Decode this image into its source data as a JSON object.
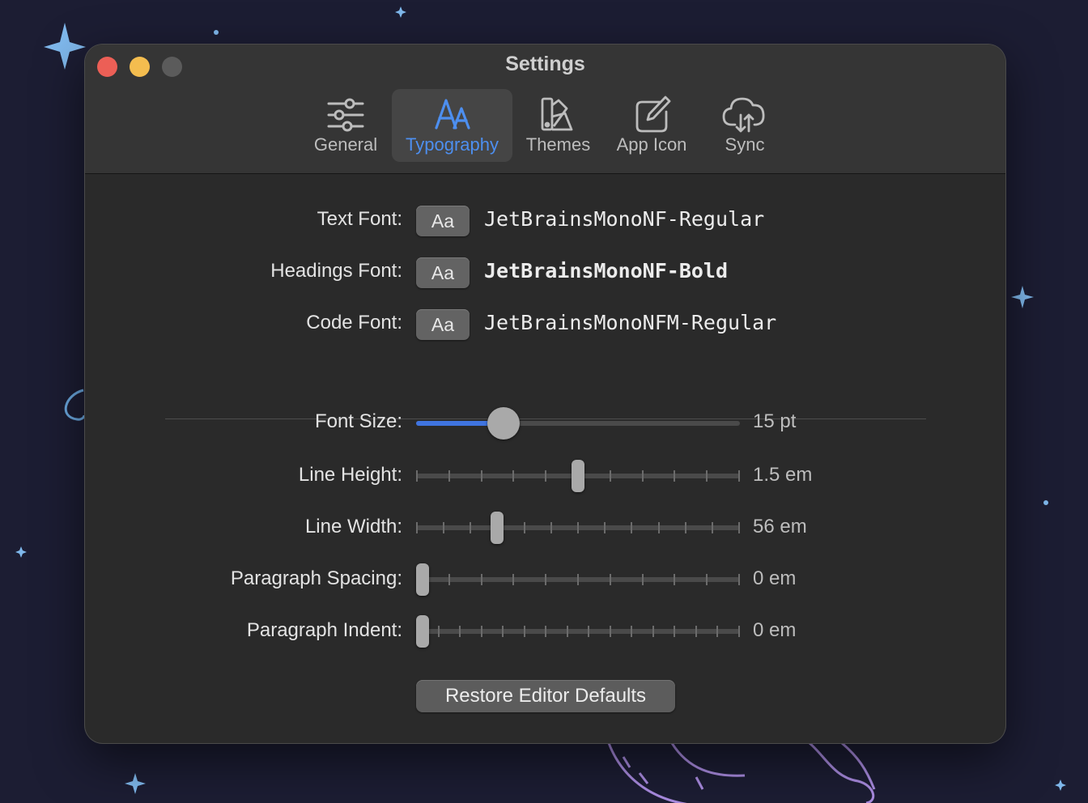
{
  "window": {
    "title": "Settings"
  },
  "tabs": [
    {
      "label": "General",
      "icon": "sliders-icon",
      "active": false
    },
    {
      "label": "Typography",
      "icon": "typography-icon",
      "active": true
    },
    {
      "label": "Themes",
      "icon": "swatches-icon",
      "active": false
    },
    {
      "label": "App Icon",
      "icon": "pencil-square-icon",
      "active": false
    },
    {
      "label": "Sync",
      "icon": "cloud-sync-icon",
      "active": false
    }
  ],
  "fonts": {
    "button_label": "Aa",
    "rows": [
      {
        "label": "Text Font:",
        "value": "JetBrainsMonoNF-Regular",
        "bold": false
      },
      {
        "label": "Headings Font:",
        "value": "JetBrainsMonoNF-Bold",
        "bold": true
      },
      {
        "label": "Code Font:",
        "value": "JetBrainsMonoNFM-Regular",
        "bold": false
      }
    ]
  },
  "sliders": [
    {
      "label": "Font Size:",
      "value": "15 pt",
      "fraction": 0.27,
      "kind": "continuous",
      "tick_count": 0
    },
    {
      "label": "Line Height:",
      "value": "1.5 em",
      "fraction": 0.5,
      "kind": "stepped",
      "tick_count": 11
    },
    {
      "label": "Line Width:",
      "value": "56 em",
      "fraction": 0.25,
      "kind": "stepped",
      "tick_count": 13
    },
    {
      "label": "Paragraph Spacing:",
      "value": "0 em",
      "fraction": 0.0,
      "kind": "stepped",
      "tick_count": 11
    },
    {
      "label": "Paragraph Indent:",
      "value": "0 em",
      "fraction": 0.0,
      "kind": "stepped",
      "tick_count": 16
    }
  ],
  "restore_button": "Restore Editor Defaults",
  "colors": {
    "accent": "#3f74e0",
    "tab_active_text": "#4d8ff0",
    "window_bg": "#2a2a2a",
    "desktop_bg": "#1c1d33"
  }
}
